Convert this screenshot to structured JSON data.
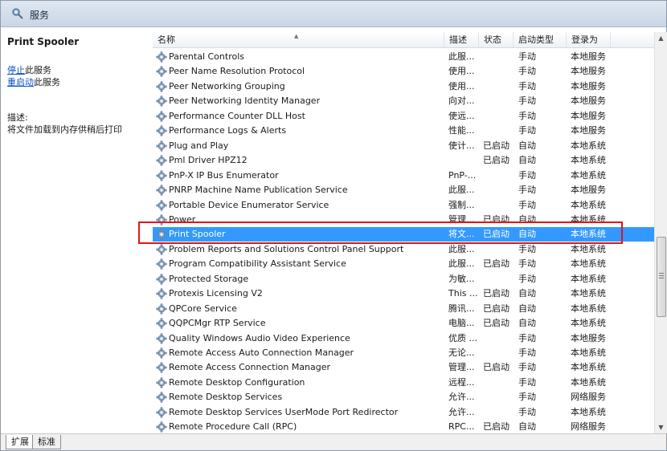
{
  "window": {
    "title": "服务"
  },
  "left_panel": {
    "service_name": "Print Spooler",
    "actions": [
      {
        "link": "停止",
        "suffix": "此服务"
      },
      {
        "link": "重启动",
        "suffix": "此服务"
      }
    ],
    "description_label": "描述:",
    "description_text": "将文件加载到内存供稍后打印"
  },
  "columns": [
    "名称",
    "描述",
    "状态",
    "启动类型",
    "登录为"
  ],
  "services": [
    {
      "name": "Parental Controls",
      "desc": "此服...",
      "state": "",
      "start": "手动",
      "logon": "本地服务"
    },
    {
      "name": "Peer Name Resolution Protocol",
      "desc": "使用...",
      "state": "",
      "start": "手动",
      "logon": "本地服务"
    },
    {
      "name": "Peer Networking Grouping",
      "desc": "使用...",
      "state": "",
      "start": "手动",
      "logon": "本地服务"
    },
    {
      "name": "Peer Networking Identity Manager",
      "desc": "向对...",
      "state": "",
      "start": "手动",
      "logon": "本地服务"
    },
    {
      "name": "Performance Counter DLL Host",
      "desc": "使远...",
      "state": "",
      "start": "手动",
      "logon": "本地服务"
    },
    {
      "name": "Performance Logs & Alerts",
      "desc": "性能...",
      "state": "",
      "start": "手动",
      "logon": "本地服务"
    },
    {
      "name": "Plug and Play",
      "desc": "使计...",
      "state": "已启动",
      "start": "自动",
      "logon": "本地系统"
    },
    {
      "name": "Pml Driver HPZ12",
      "desc": "",
      "state": "已启动",
      "start": "自动",
      "logon": "本地系统"
    },
    {
      "name": "PnP-X IP Bus Enumerator",
      "desc": "PnP-...",
      "state": "",
      "start": "手动",
      "logon": "本地系统"
    },
    {
      "name": "PNRP Machine Name Publication Service",
      "desc": "此服...",
      "state": "",
      "start": "手动",
      "logon": "本地服务"
    },
    {
      "name": "Portable Device Enumerator Service",
      "desc": "强制...",
      "state": "",
      "start": "手动",
      "logon": "本地系统"
    },
    {
      "name": "Power",
      "desc": "管理...",
      "state": "已启动",
      "start": "自动",
      "logon": "本地系统"
    },
    {
      "name": "Print Spooler",
      "desc": "将文...",
      "state": "已启动",
      "start": "自动",
      "logon": "本地系统",
      "selected": true
    },
    {
      "name": "Problem Reports and Solutions Control Panel Support",
      "desc": "此服...",
      "state": "",
      "start": "手动",
      "logon": "本地系统"
    },
    {
      "name": "Program Compatibility Assistant Service",
      "desc": "此服...",
      "state": "已启动",
      "start": "手动",
      "logon": "本地系统"
    },
    {
      "name": "Protected Storage",
      "desc": "为敏...",
      "state": "",
      "start": "手动",
      "logon": "本地系统"
    },
    {
      "name": "Protexis Licensing V2",
      "desc": "This ...",
      "state": "已启动",
      "start": "自动",
      "logon": "本地系统"
    },
    {
      "name": "QPCore Service",
      "desc": "腾讯...",
      "state": "已启动",
      "start": "自动",
      "logon": "本地系统"
    },
    {
      "name": "QQPCMgr RTP Service",
      "desc": "电脑...",
      "state": "已启动",
      "start": "自动",
      "logon": "本地系统"
    },
    {
      "name": "Quality Windows Audio Video Experience",
      "desc": "优质 ...",
      "state": "",
      "start": "手动",
      "logon": "本地服务"
    },
    {
      "name": "Remote Access Auto Connection Manager",
      "desc": "无论...",
      "state": "",
      "start": "手动",
      "logon": "本地系统"
    },
    {
      "name": "Remote Access Connection Manager",
      "desc": "管理...",
      "state": "已启动",
      "start": "手动",
      "logon": "本地系统"
    },
    {
      "name": "Remote Desktop Configuration",
      "desc": "远程...",
      "state": "",
      "start": "手动",
      "logon": "本地系统"
    },
    {
      "name": "Remote Desktop Services",
      "desc": "允许...",
      "state": "",
      "start": "手动",
      "logon": "网络服务"
    },
    {
      "name": "Remote Desktop Services UserMode Port Redirector",
      "desc": "允许...",
      "state": "",
      "start": "手动",
      "logon": "本地系统"
    },
    {
      "name": "Remote Procedure Call (RPC)",
      "desc": "RPC...",
      "state": "已启动",
      "start": "自动",
      "logon": "网络服务"
    }
  ],
  "bottom_tabs": [
    "扩展",
    "标准"
  ],
  "colors": {
    "selection": "#3399ff",
    "highlight_box": "#e0161b"
  }
}
